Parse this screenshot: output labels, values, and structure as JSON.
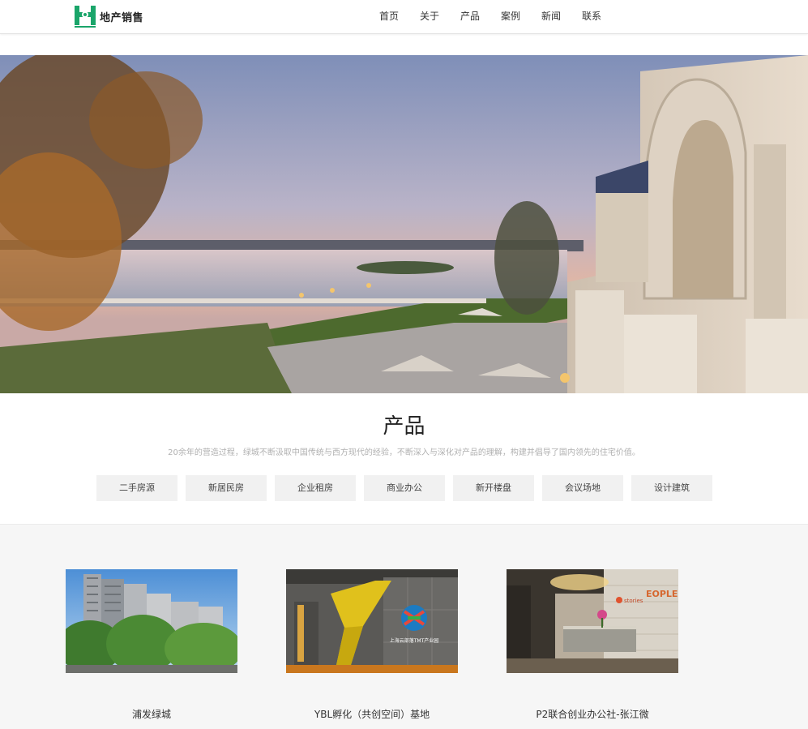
{
  "header": {
    "brand": "地产销售",
    "nav": [
      "首页",
      "关于",
      "产品",
      "案例",
      "新闻",
      "联系"
    ]
  },
  "products": {
    "title": "产品",
    "description": "20余年的营造过程，绿城不断汲取中国传统与西方现代的经验，不断深入与深化对产品的理解，构建并倡导了国内领先的住宅价值。",
    "tabs": [
      "二手房源",
      "新居民房",
      "企业租房",
      "商业办公",
      "新开楼盘",
      "会议场地",
      "设计建筑"
    ],
    "cards": [
      {
        "caption": "浦发绿城"
      },
      {
        "caption": "YBL孵化（共创空间）基地"
      },
      {
        "caption": "P2联合创业办公社-张江微"
      }
    ]
  },
  "image_text": {
    "park_sign_cn": "上海云部落TMT产业园",
    "stories_sign": "stories",
    "people_sign": "EOPLE"
  },
  "colors": {
    "brand_green": "#1aa56a",
    "tab_bg": "#f1f1f1",
    "gallery_bg": "#f6f6f6"
  }
}
